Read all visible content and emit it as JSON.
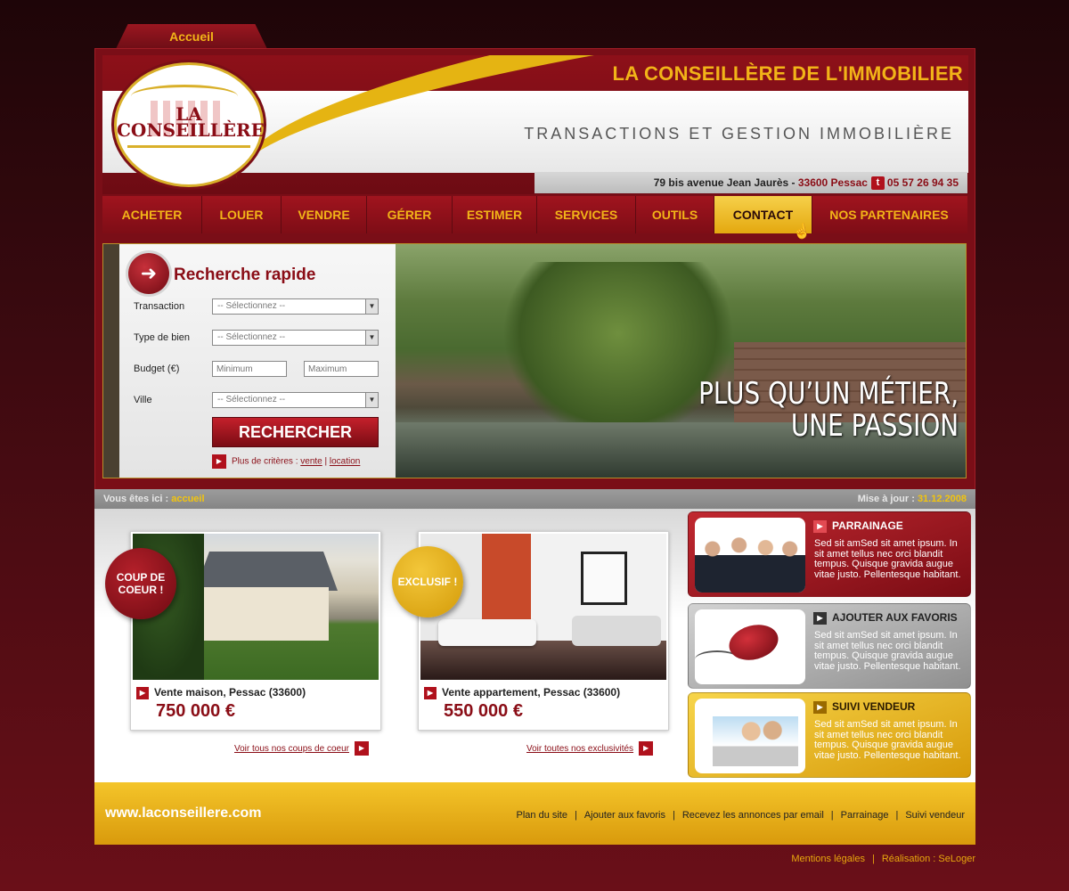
{
  "top_tab": {
    "label": "Accueil"
  },
  "header": {
    "title": "LA CONSEILLÈRE DE L'IMMOBILIER",
    "subtitle": "TRANSACTIONS ET GESTION IMMOBILIÈRE",
    "logo_text_1": "LA",
    "logo_text_2": "CONSEILLÈRE",
    "address_street": "79 bis avenue Jean Jaurès - ",
    "address_city": "33600 Pessac",
    "phone_icon": "t",
    "phone": "05 57 26 94 35"
  },
  "nav": {
    "items": [
      {
        "label": "ACHETER"
      },
      {
        "label": "LOUER"
      },
      {
        "label": "VENDRE"
      },
      {
        "label": "GÉRER"
      },
      {
        "label": "ESTIMER"
      },
      {
        "label": "SERVICES"
      },
      {
        "label": "OUTILS"
      },
      {
        "label": "CONTACT"
      },
      {
        "label": "NOS PARTENAIRES"
      }
    ],
    "active": "CONTACT"
  },
  "search": {
    "title": "Recherche rapide",
    "transaction_label": "Transaction",
    "type_label": "Type de bien",
    "budget_label": "Budget (€)",
    "city_label": "Ville",
    "select_placeholder": "-- Sélectionnez --",
    "min_placeholder": "Minimum",
    "max_placeholder": "Maximum",
    "button_label": "RECHERCHER",
    "more_prefix": "Plus de critères : ",
    "more_link_1": "vente",
    "more_sep": " | ",
    "more_link_2": "location"
  },
  "banner": {
    "line1": "PLUS QU’UN MÉTIER,",
    "line2": "UNE PASSION"
  },
  "breadcrumb": {
    "prefix": "Vous êtes ici : ",
    "current": "accueil",
    "update_label": "Mise à jour : ",
    "update_date": "31.12.2008"
  },
  "listings": [
    {
      "badge": "COUP DE COEUR !",
      "title": "Vente maison, Pessac (33600)",
      "price": "750 000 €",
      "see_all": "Voir tous nos coups de coeur"
    },
    {
      "badge": "EXCLUSIF !",
      "title": "Vente appartement, Pessac (33600)",
      "price": "550 000 €",
      "see_all": "Voir toutes nos exclusivités"
    }
  ],
  "promos": [
    {
      "title": "PARRAINAGE",
      "text": "Sed sit amSed sit amet ipsum. In sit amet tellus nec orci blandit tempus. Quisque gravida augue vitae justo. Pellentesque habitant."
    },
    {
      "title": "AJOUTER AUX FAVORIS",
      "text": "Sed sit amSed sit amet ipsum. In sit amet tellus nec orci blandit tempus. Quisque gravida augue vitae justo. Pellentesque habitant."
    },
    {
      "title": "SUIVI VENDEUR",
      "text": "Sed sit amSed sit amet ipsum. In sit amet tellus nec orci blandit tempus. Quisque gravida augue vitae justo. Pellentesque habitant."
    }
  ],
  "footer": {
    "url": "www.laconseillere.com",
    "links": [
      "Plan du site",
      "Ajouter aux favoris",
      "Recevez les annonces par email",
      "Parrainage",
      "Suivi vendeur"
    ],
    "separator": "|",
    "legal_1": "Mentions légales",
    "legal_2": "Réalisation : SeLoger"
  },
  "colors": {
    "brand_red": "#8a0d16",
    "brand_gold": "#f2b418",
    "nav_active": "#f6d04a"
  }
}
